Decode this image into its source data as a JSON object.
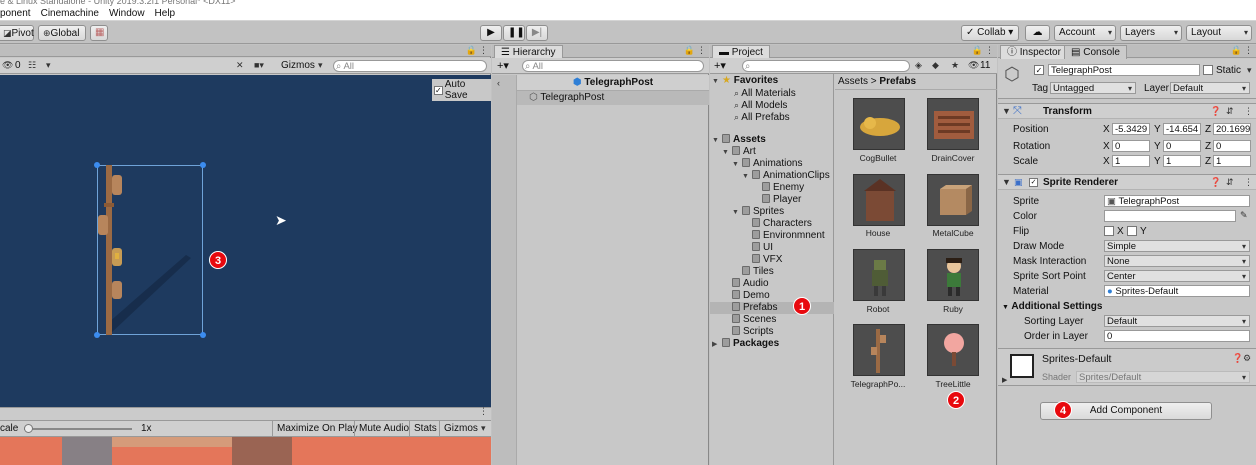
{
  "title_bar": {
    "text": "e & Linux Standalone - Unity 2019.3.2f1 Personal* <DX11>"
  },
  "menu": [
    "ponent",
    "Cinemachine",
    "Window",
    "Help"
  ],
  "toolbar": {
    "pivot": "Pivot",
    "global": "Global",
    "collab": "Collab ▾",
    "account": "Account",
    "layers": "Layers",
    "layout": "Layout"
  },
  "scene": {
    "layer_count": "0",
    "gizmos": "Gizmos",
    "search_placeholder": "All",
    "auto_save": "Auto Save",
    "game_bar": {
      "scale": "cale",
      "scale_value": "1x",
      "maximize": "Maximize On Play",
      "mute": "Mute Audio",
      "stats": "Stats",
      "gizmos": "Gizmos"
    }
  },
  "hierarchy": {
    "tab": "Hierarchy",
    "search_placeholder": "All",
    "scene_title": "TelegraphPost",
    "item": "TelegraphPost"
  },
  "project": {
    "tab": "Project",
    "count": "11",
    "favorites": {
      "label": "Favorites",
      "items": [
        "All Materials",
        "All Models",
        "All Prefabs"
      ]
    },
    "assets": {
      "label": "Assets",
      "art": "Art",
      "animations": "Animations",
      "animation_clips": "AnimationClips",
      "enemy": "Enemy",
      "player": "Player",
      "sprites": "Sprites",
      "characters": "Characters",
      "environment": "Environmnent",
      "ui": "UI",
      "vfx": "VFX",
      "tiles": "Tiles",
      "audio": "Audio",
      "demo": "Demo",
      "prefabs": "Prefabs",
      "scenes": "Scenes",
      "scripts": "Scripts"
    },
    "packages": "Packages",
    "breadcrumb": {
      "root": "Assets",
      "sep": ">",
      "current": "Prefabs"
    },
    "thumbs": [
      "CogBullet",
      "DrainCover",
      "House",
      "MetalCube",
      "Robot",
      "Ruby",
      "TelegraphPo...",
      "TreeLittle"
    ]
  },
  "inspector": {
    "tab": "Inspector",
    "console_tab": "Console",
    "object_name": "TelegraphPost",
    "static": "Static",
    "tag_label": "Tag",
    "tag_value": "Untagged",
    "layer_label": "Layer",
    "layer_value": "Default",
    "transform": {
      "title": "Transform",
      "position": {
        "label": "Position",
        "x": "-5.3429",
        "y": "-14.654",
        "z": "20.1699"
      },
      "rotation": {
        "label": "Rotation",
        "x": "0",
        "y": "0",
        "z": "0"
      },
      "scale": {
        "label": "Scale",
        "x": "1",
        "y": "1",
        "z": "1"
      }
    },
    "axis": {
      "x": "X",
      "y": "Y",
      "z": "Z"
    },
    "sprite_renderer": {
      "title": "Sprite Renderer",
      "sprite_label": "Sprite",
      "sprite_value": "TelegraphPost",
      "color_label": "Color",
      "flip_label": "Flip",
      "flip_x": "X",
      "flip_y": "Y",
      "draw_mode_label": "Draw Mode",
      "draw_mode": "Simple",
      "mask_label": "Mask Interaction",
      "mask": "None",
      "sort_point_label": "Sprite Sort Point",
      "sort_point": "Center",
      "material_label": "Material",
      "material": "Sprites-Default",
      "additional": "Additional Settings",
      "sorting_layer_label": "Sorting Layer",
      "sorting_layer": "Default",
      "order_label": "Order in Layer",
      "order": "0"
    },
    "material_block": {
      "name": "Sprites-Default",
      "shader_label": "Shader",
      "shader": "Sprites/Default"
    },
    "add_component": "Add Component"
  },
  "badges": [
    "1",
    "2",
    "3",
    "4"
  ],
  "colors": {
    "scene_bg": "#1e3a5f",
    "badge": "#e8090e",
    "game_bg": "#e4765a"
  }
}
